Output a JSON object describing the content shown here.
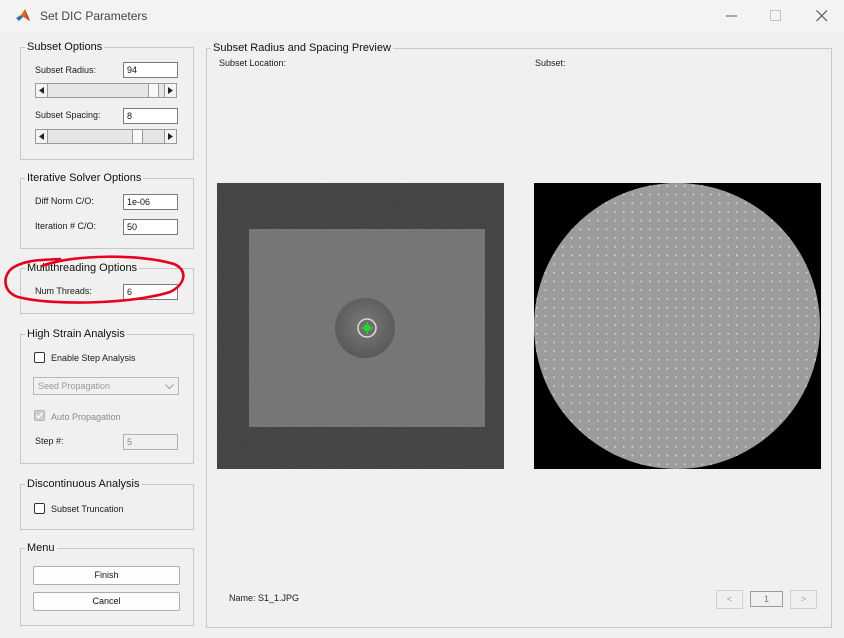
{
  "window": {
    "title": "Set DIC Parameters"
  },
  "subset_options": {
    "legend": "Subset Options",
    "radius_label": "Subset Radius:",
    "radius_value": "94",
    "radius_slider_fraction": 0.95,
    "spacing_label": "Subset Spacing:",
    "spacing_value": "8",
    "spacing_slider_fraction": 0.8
  },
  "iterative_solver": {
    "legend": "Iterative Solver Options",
    "diff_norm_label": "Diff Norm C/O:",
    "diff_norm_value": "1e-06",
    "iteration_label": "Iteration # C/O:",
    "iteration_value": "50"
  },
  "multithreading": {
    "legend": "Multithreading Options",
    "threads_label": "Num Threads:",
    "threads_value": "6"
  },
  "high_strain": {
    "legend": "High Strain Analysis",
    "step_analysis_label": "Enable Step Analysis",
    "propagation_selected": "Seed Propagation",
    "auto_propagation_label": "Auto Propagation",
    "step_label": "Step #:",
    "step_value": "5"
  },
  "discontinuous": {
    "legend": "Discontinuous Analysis",
    "truncation_label": "Subset Truncation"
  },
  "menu": {
    "legend": "Menu",
    "finish_label": "Finish",
    "cancel_label": "Cancel"
  },
  "preview": {
    "legend": "Subset Radius and Spacing Preview",
    "location_label": "Subset Location:",
    "subset_label": "Subset:",
    "name_text": "Name: S1_1.JPG",
    "prev_label": "<",
    "page_value": "1",
    "next_label": ">"
  },
  "colors": {
    "annotation": "#e8001c",
    "seed_marker": "#22dd22",
    "matlab_orange": "#e2661a"
  },
  "icons": {
    "app": "matlab-icon",
    "minimize": "minimize-icon",
    "maximize": "maximize-icon",
    "close": "close-icon"
  }
}
